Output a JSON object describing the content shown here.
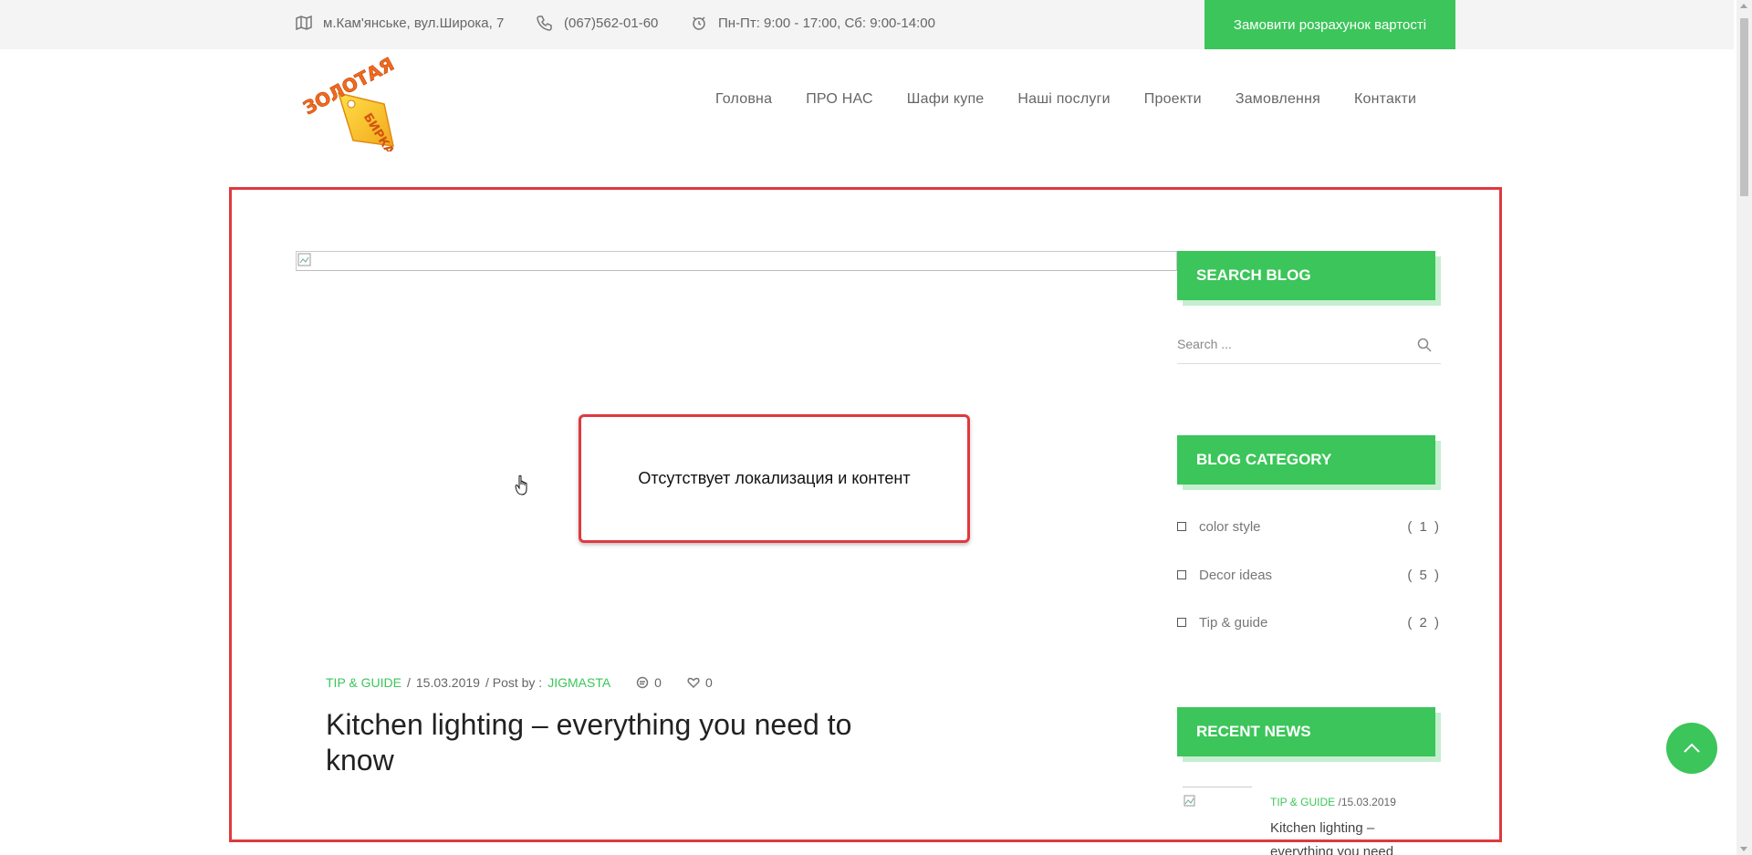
{
  "topbar": {
    "address": "м.Кам'янське, вул.Широка, 7",
    "phone": "(067)562-01-60",
    "hours": "Пн-Пт: 9:00 - 17:00, Сб: 9:00-14:00",
    "cta_label": "Замовити розрахунок вартості",
    "address_icon": "map-icon",
    "phone_icon": "phone-icon",
    "hours_icon": "clock-icon"
  },
  "logo": {
    "text_top": "ЗОЛОТАЯ",
    "text_tag": "БИРКА"
  },
  "nav": {
    "items": [
      "Головна",
      "ПРО НАС",
      "Шафи купе",
      "Наші послуги",
      "Проекти",
      "Замовлення",
      "Контакти"
    ]
  },
  "annotation": {
    "message": "Отсутствует локализация и контент"
  },
  "post": {
    "category": "TIP & GUIDE",
    "separator1": " / ",
    "date": "15.03.2019",
    "post_by_label": " / Post by : ",
    "author": "JIGMASTA",
    "comments_count": "0",
    "likes_count": "0",
    "title": "Kitchen lighting – everything you need to know"
  },
  "sidebar": {
    "search": {
      "heading": "SEARCH BLOG",
      "placeholder": "Search ..."
    },
    "categories": {
      "heading": "BLOG CATEGORY",
      "items": [
        {
          "label": "color style",
          "count": "( 1 )"
        },
        {
          "label": "Decor ideas",
          "count": "( 5 )"
        },
        {
          "label": "Tip & guide",
          "count": "( 2 )"
        }
      ]
    },
    "recent": {
      "heading": "RECENT NEWS",
      "items": [
        {
          "category": "TIP & GUIDE",
          "date": "/15.03.2019",
          "title": "Kitchen lighting – everything you need"
        }
      ]
    }
  },
  "colors": {
    "accent": "#3cc55a",
    "highlight": "#e0393f"
  }
}
